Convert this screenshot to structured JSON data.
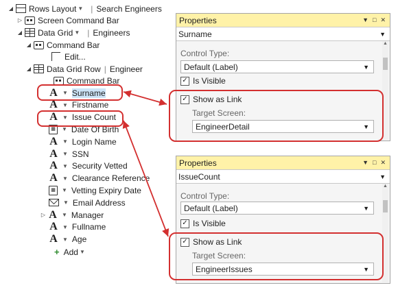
{
  "tree": {
    "root_label": "Rows Layout",
    "root_sub": "Search Engineers",
    "screen_command_bar": "Screen Command Bar",
    "data_grid_label": "Data Grid",
    "data_grid_sub": "Engineers",
    "command_bar": "Command Bar",
    "edit": "Edit...",
    "row_label": "Data Grid Row",
    "row_sub": "Engineer",
    "row_command_bar": "Command Bar",
    "fields": [
      {
        "label": "Surname",
        "icon": "label-icon"
      },
      {
        "label": "Firstname",
        "icon": "label-icon"
      },
      {
        "label": "Issue Count",
        "icon": "label-icon"
      },
      {
        "label": "Date Of Birth",
        "icon": "date-picker-icon"
      },
      {
        "label": "Login Name",
        "icon": "label-icon"
      },
      {
        "label": "SSN",
        "icon": "label-icon"
      },
      {
        "label": "Security Vetted",
        "icon": "label-icon"
      },
      {
        "label": "Clearance Reference",
        "icon": "label-icon"
      },
      {
        "label": "Vetting Expiry Date",
        "icon": "date-picker-icon"
      },
      {
        "label": "Email Address",
        "icon": "email-icon"
      },
      {
        "label": "Manager",
        "icon": "label-icon"
      },
      {
        "label": "Fullname",
        "icon": "label-icon"
      },
      {
        "label": "Age",
        "icon": "label-icon"
      }
    ],
    "add": "Add"
  },
  "panel1": {
    "title": "Properties",
    "object": "Surname",
    "control_type_label": "Control Type:",
    "control_type_value": "Default (Label)",
    "is_visible": "Is Visible",
    "show_as_link": "Show as Link",
    "target_screen_label": "Target Screen:",
    "target_screen_value": "EngineerDetail"
  },
  "panel2": {
    "title": "Properties",
    "object": "IssueCount",
    "control_type_label": "Control Type:",
    "control_type_value": "Default (Label)",
    "is_visible": "Is Visible",
    "show_as_link": "Show as Link",
    "target_screen_label": "Target Screen:",
    "target_screen_value": "EngineerIssues"
  },
  "colors": {
    "panel_title_bg": "#fff2a8",
    "highlight": "#cce4f7",
    "annotation_red": "#d32f2f",
    "add_plus": "#2e8b2e"
  }
}
